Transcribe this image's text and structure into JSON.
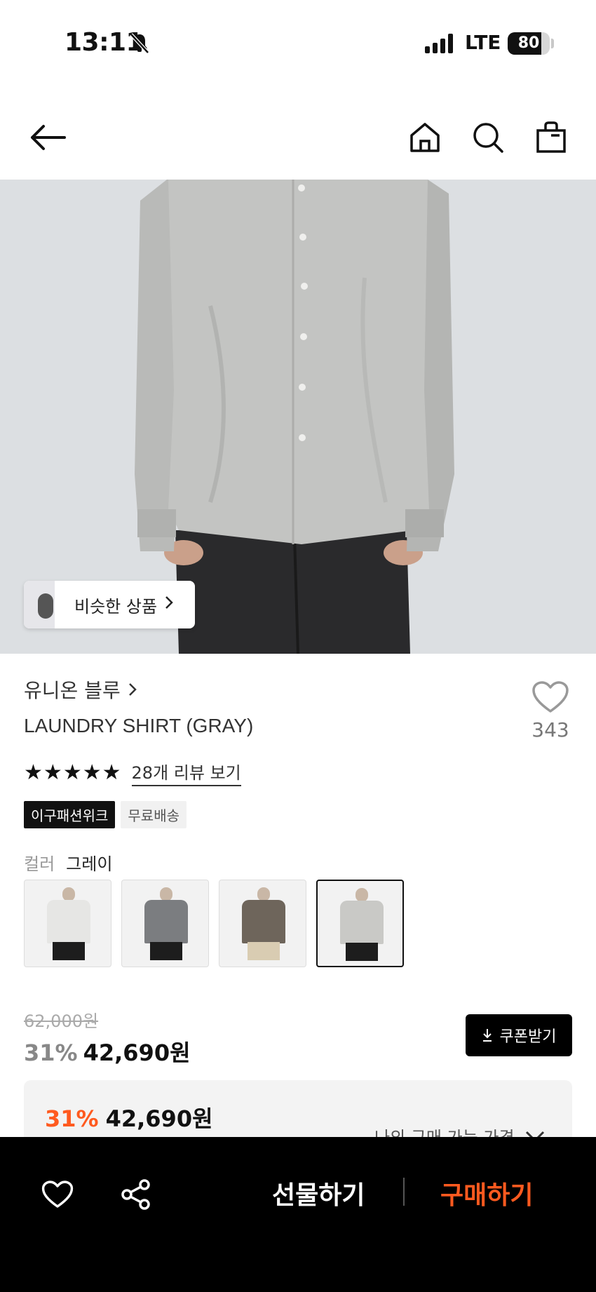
{
  "status_bar": {
    "time": "13:11",
    "network": "LTE",
    "battery": "80",
    "battery_level": 0.8
  },
  "nav": {
    "back_icon": "arrow-left-icon",
    "home_icon": "home-icon",
    "search_icon": "search-icon",
    "bag_icon": "shopping-bag-icon"
  },
  "hero": {
    "similar_label": "비슷한 상품"
  },
  "product": {
    "brand": "유니온 블루",
    "title": "LAUNDRY SHIRT (GRAY)",
    "like_count": "343",
    "rating_stars": 5,
    "review_link": "28개 리뷰 보기",
    "badges": [
      "이구패션위크",
      "무료배송"
    ],
    "color_label": "컬러",
    "color_value": "그레이",
    "swatches": [
      {
        "color": "#e6e6e4",
        "selected": false
      },
      {
        "color": "#7b7d80",
        "selected": false
      },
      {
        "color": "#6e655b",
        "selected": false
      },
      {
        "color": "#c9c9c6",
        "selected": true
      }
    ]
  },
  "pricing": {
    "original_price": "62,000원",
    "discount": "31%",
    "sale_price": "42,690원",
    "coupon_label": "쿠폰받기",
    "my_price_label": "나의 구매 가능 가격",
    "panel_discount": "31%",
    "panel_price": "42,690원"
  },
  "bottom_bar": {
    "gift_label": "선물하기",
    "buy_label": "구매하기"
  },
  "colors": {
    "accent": "#ff5a1f",
    "black": "#000000"
  }
}
